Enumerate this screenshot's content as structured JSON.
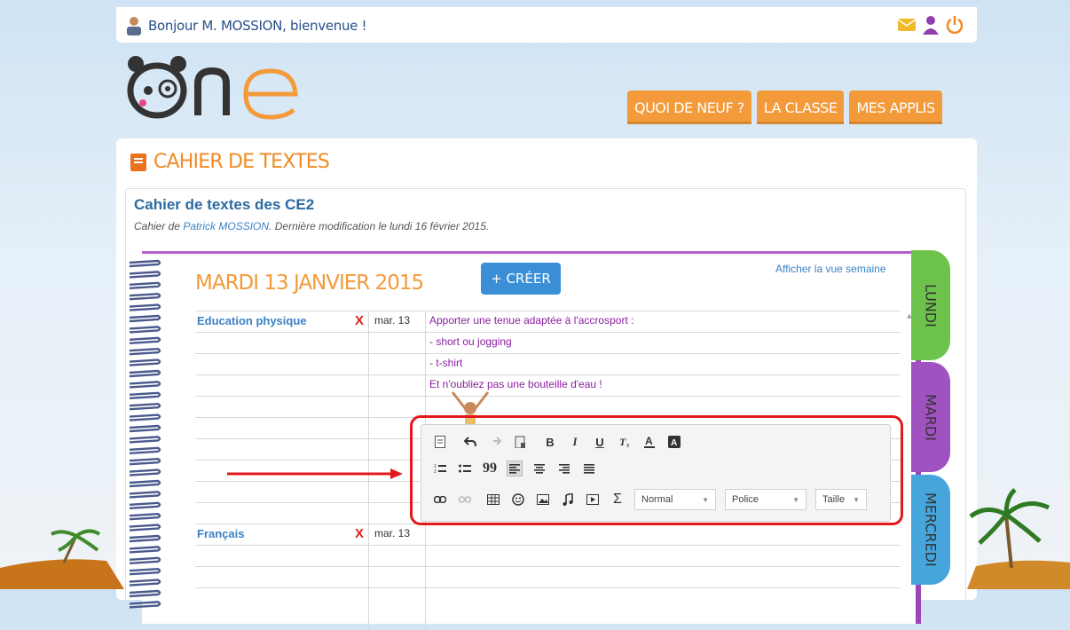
{
  "topbar": {
    "greeting": "Bonjour M. MOSSION, bienvenue !",
    "icons": [
      "mail-icon",
      "user-icon",
      "power-icon"
    ]
  },
  "logo": {
    "text": "one"
  },
  "nav": {
    "items": [
      "QUOI DE NEUF ?",
      "LA CLASSE",
      "MES APPLIS"
    ]
  },
  "page": {
    "section_title": "CAHIER DE TEXTES",
    "cahier_title": "Cahier de textes des CE2",
    "subtitle_prefix": "Cahier de ",
    "author": "Patrick MOSSION",
    "subtitle_suffix": ". Dernière modification le lundi 16 février 2015."
  },
  "day": {
    "title": "MARDI 13 JANVIER 2015",
    "create_label": "+ CRÉER",
    "week_view_link": "Afficher la vue semaine"
  },
  "entries": [
    {
      "subject": "Education physique",
      "delete": "X",
      "date": "mar. 13",
      "lines": [
        "Apporter une tenue adaptée à l'accrosport :",
        "- short ou jogging",
        "- t-shirt",
        "Et n'oubliez pas une bouteille d'eau !"
      ]
    },
    {
      "subject": "Français",
      "delete": "X",
      "date": "mar. 13",
      "lines": []
    }
  ],
  "day_tabs": [
    "LUNDI",
    "MARDI",
    "MERCREDI"
  ],
  "editor": {
    "row1": [
      "new-doc-icon",
      "undo-icon",
      "redo-icon",
      "paste-icon",
      "bold-icon",
      "italic-icon",
      "underline-icon",
      "clear-format-icon",
      "text-color-icon",
      "bg-color-icon"
    ],
    "row2": [
      "numbered-list-icon",
      "bullet-list-icon",
      "blockquote-icon",
      "align-left-icon",
      "align-center-icon",
      "align-right-icon",
      "justify-icon"
    ],
    "row3": [
      "link-icon",
      "unlink-icon",
      "table-icon",
      "smiley-icon",
      "image-icon",
      "music-icon",
      "video-icon",
      "sigma-icon"
    ],
    "dropdowns": {
      "format": "Normal",
      "font": "Police",
      "size": "Taille"
    },
    "glyphs": {
      "bold": "B",
      "italic": "I",
      "underline": "U",
      "sigma": "Σ",
      "quote": "99"
    }
  },
  "colors": {
    "orange": "#f39a3a",
    "blue": "#3b82c4",
    "purple": "#8a1fa0",
    "red": "#e2191c",
    "tab_lundi": "#6cc24a",
    "tab_mardi": "#a052c0",
    "tab_mercredi": "#46a6dc"
  }
}
